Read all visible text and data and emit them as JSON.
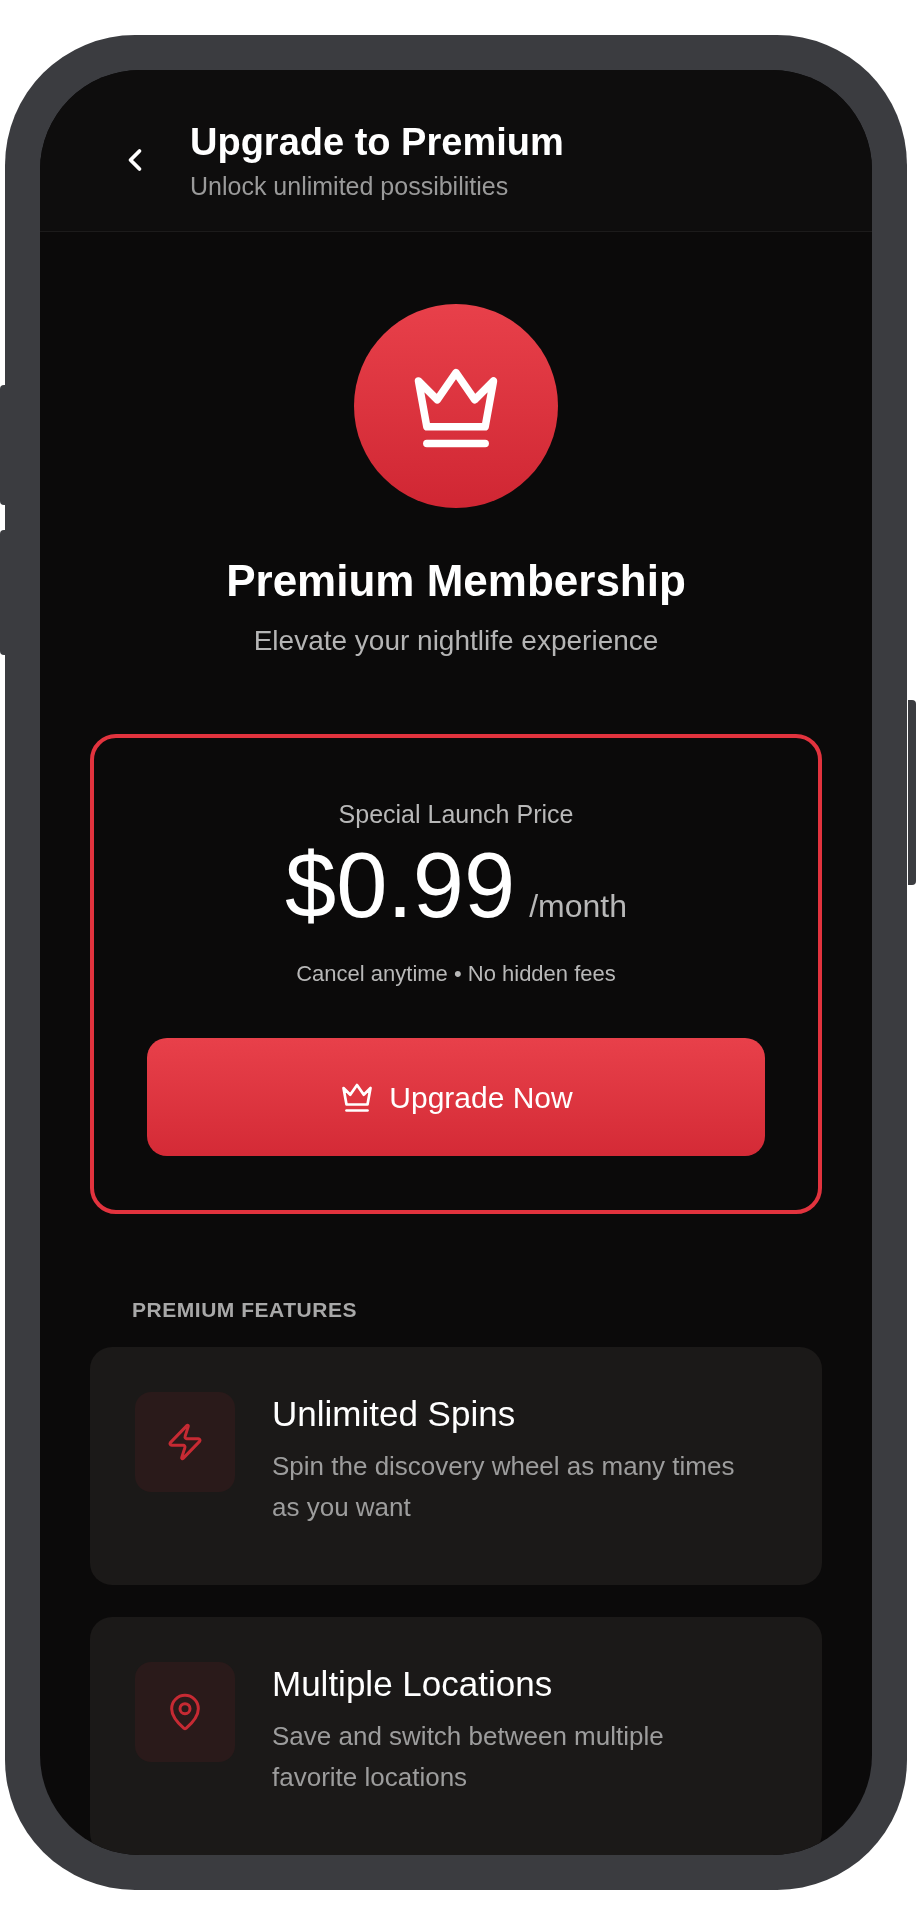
{
  "header": {
    "title": "Upgrade to Premium",
    "subtitle": "Unlock unlimited possibilities"
  },
  "hero": {
    "title": "Premium Membership",
    "subtitle": "Elevate your nightlife experience"
  },
  "price_card": {
    "label": "Special Launch Price",
    "price": "$0.99",
    "period": "/month",
    "note": "Cancel anytime • No hidden fees",
    "button": "Upgrade Now"
  },
  "features": {
    "heading": "PREMIUM FEATURES",
    "items": [
      {
        "kind": "bolt",
        "title": "Unlimited Spins",
        "description": "Spin the discovery wheel as many times as you want"
      },
      {
        "kind": "pin",
        "title": "Multiple Locations",
        "description": "Save and switch between multiple favorite locations"
      }
    ]
  }
}
